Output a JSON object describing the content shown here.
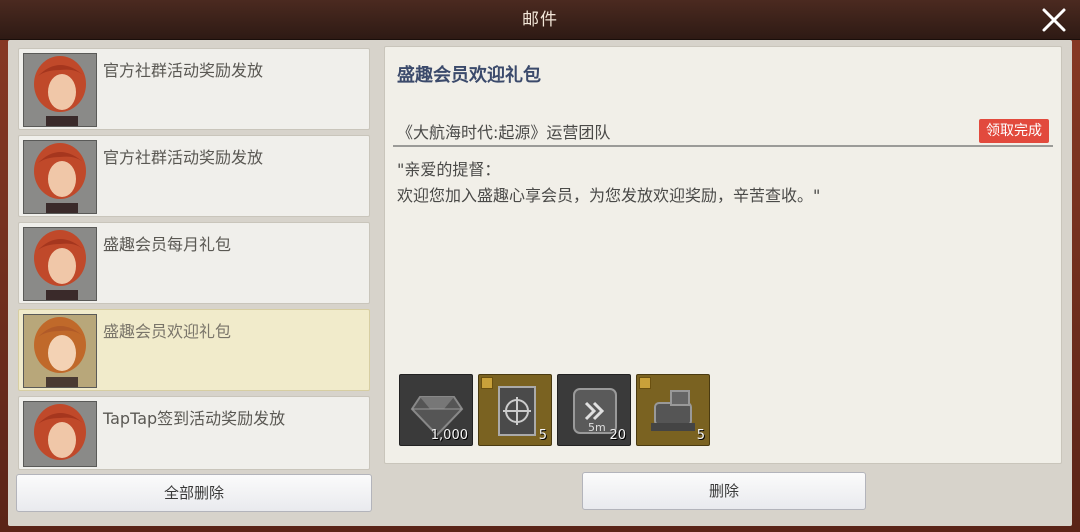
{
  "window": {
    "title": "邮件"
  },
  "mail_list": [
    {
      "subject": "官方社群活动奖励发放"
    },
    {
      "subject": "官方社群活动奖励发放"
    },
    {
      "subject": "盛趣会员每月礼包"
    },
    {
      "subject": "盛趣会员欢迎礼包"
    },
    {
      "subject": "TapTap签到活动奖励发放"
    }
  ],
  "selected_index": 3,
  "actions": {
    "delete_all_label": "全部删除",
    "delete_label": "删除"
  },
  "detail": {
    "title": "盛趣会员欢迎礼包",
    "sender": "《大航海时代:起源》运营团队",
    "status_badge": "领取完成",
    "body": "\"亲爱的提督：\n欢迎您加入盛趣心享会员，为您发放欢迎奖励，辛苦查收。\"",
    "rewards": [
      {
        "icon": "diamond-icon",
        "quantity": "1,000"
      },
      {
        "icon": "ship-blueprint-icon",
        "quantity": "5"
      },
      {
        "icon": "speed-up-icon",
        "quantity": "20",
        "icon_label": "5m"
      },
      {
        "icon": "cannon-part-icon",
        "quantity": "5"
      }
    ]
  },
  "colors": {
    "badge": "#e24a3d",
    "title": "#3b4a6b",
    "selected_item": "#f1ebcb"
  }
}
